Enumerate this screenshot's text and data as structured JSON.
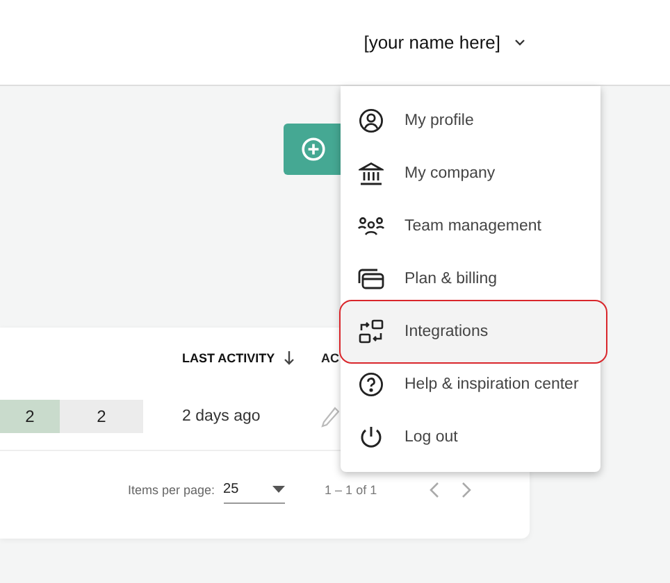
{
  "header": {
    "user_name": "[your name here]"
  },
  "table": {
    "columns": [
      {
        "label": "LAST ACTIVITY",
        "sorted": true
      },
      {
        "label": "AC"
      }
    ],
    "rows": [
      {
        "cells": [
          {
            "value": "2",
            "color": "#c9dbcc"
          },
          {
            "value": "2",
            "color": "#ececec"
          }
        ],
        "last_activity": "2 days ago"
      }
    ],
    "pagination": {
      "items_per_page_label": "Items per page:",
      "items_per_page": "25",
      "range": "1 – 1 of 1"
    }
  },
  "menu": {
    "items": [
      {
        "kind": "profile",
        "label": "My profile",
        "highlighted": false
      },
      {
        "kind": "company",
        "label": "My company",
        "highlighted": false
      },
      {
        "kind": "team",
        "label": "Team management",
        "highlighted": false
      },
      {
        "kind": "billing",
        "label": "Plan & billing",
        "highlighted": false
      },
      {
        "kind": "integrations",
        "label": "Integrations",
        "highlighted": true
      },
      {
        "kind": "help",
        "label": "Help & inspiration center",
        "highlighted": false
      },
      {
        "kind": "logout",
        "label": "Log out",
        "highlighted": false
      }
    ]
  }
}
